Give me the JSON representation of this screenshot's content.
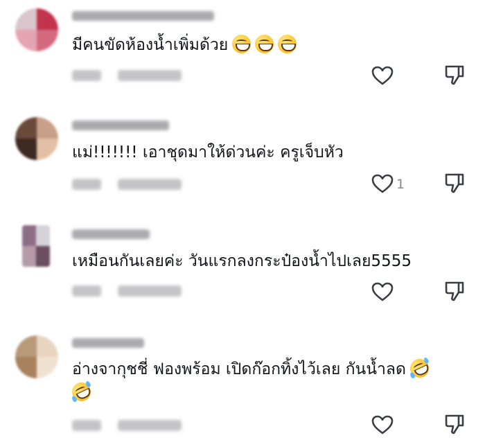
{
  "comments": [
    {
      "text": "มีคนขัดห้องน้ำเพิ่มด้วย",
      "emojis": [
        "grinning-face",
        "grinning-face",
        "grinning-face"
      ],
      "like_count": "",
      "avatar_colors": [
        "#d9c6cc",
        "#c2344c",
        "#e6a4b3",
        "#d46a80"
      ]
    },
    {
      "text": "แม่!!!!!!! เอาชุดมาให้ด่วนค่ะ ครูเจ็บหัว",
      "emojis": [],
      "like_count": "1",
      "avatar_colors": [
        "#6a4a3a",
        "#c8a08a",
        "#3d2a22",
        "#e2c0a8"
      ]
    },
    {
      "text": "เหมือนกันเลยค่ะ วันแรกลงกระป๋องน้ำไปเลย5555",
      "emojis": [],
      "like_count": "",
      "avatar_colors": [
        "#8c6f87",
        "#d7d2da",
        "#b59aa8",
        "#6b4e60"
      ]
    },
    {
      "text": "อ่างจากุชชี่ ฟองพร้อม เปิดก๊อกทิ้งไว้เลย กันน้ำลด",
      "emojis": [
        "rolling-on-floor-laughing",
        "rolling-on-floor-laughing"
      ],
      "like_count": "",
      "avatar_colors": [
        "#b89a7a",
        "#e8d6c2",
        "#a7825c",
        "#f0e2d0"
      ]
    }
  ],
  "icons": {
    "like": "heart-outline-icon",
    "dislike": "thumbs-down-outline-icon"
  },
  "colors": {
    "text": "#111318",
    "icon": "#3b3d45",
    "muted": "#8a8b91",
    "emoji": "#ffc83a"
  }
}
